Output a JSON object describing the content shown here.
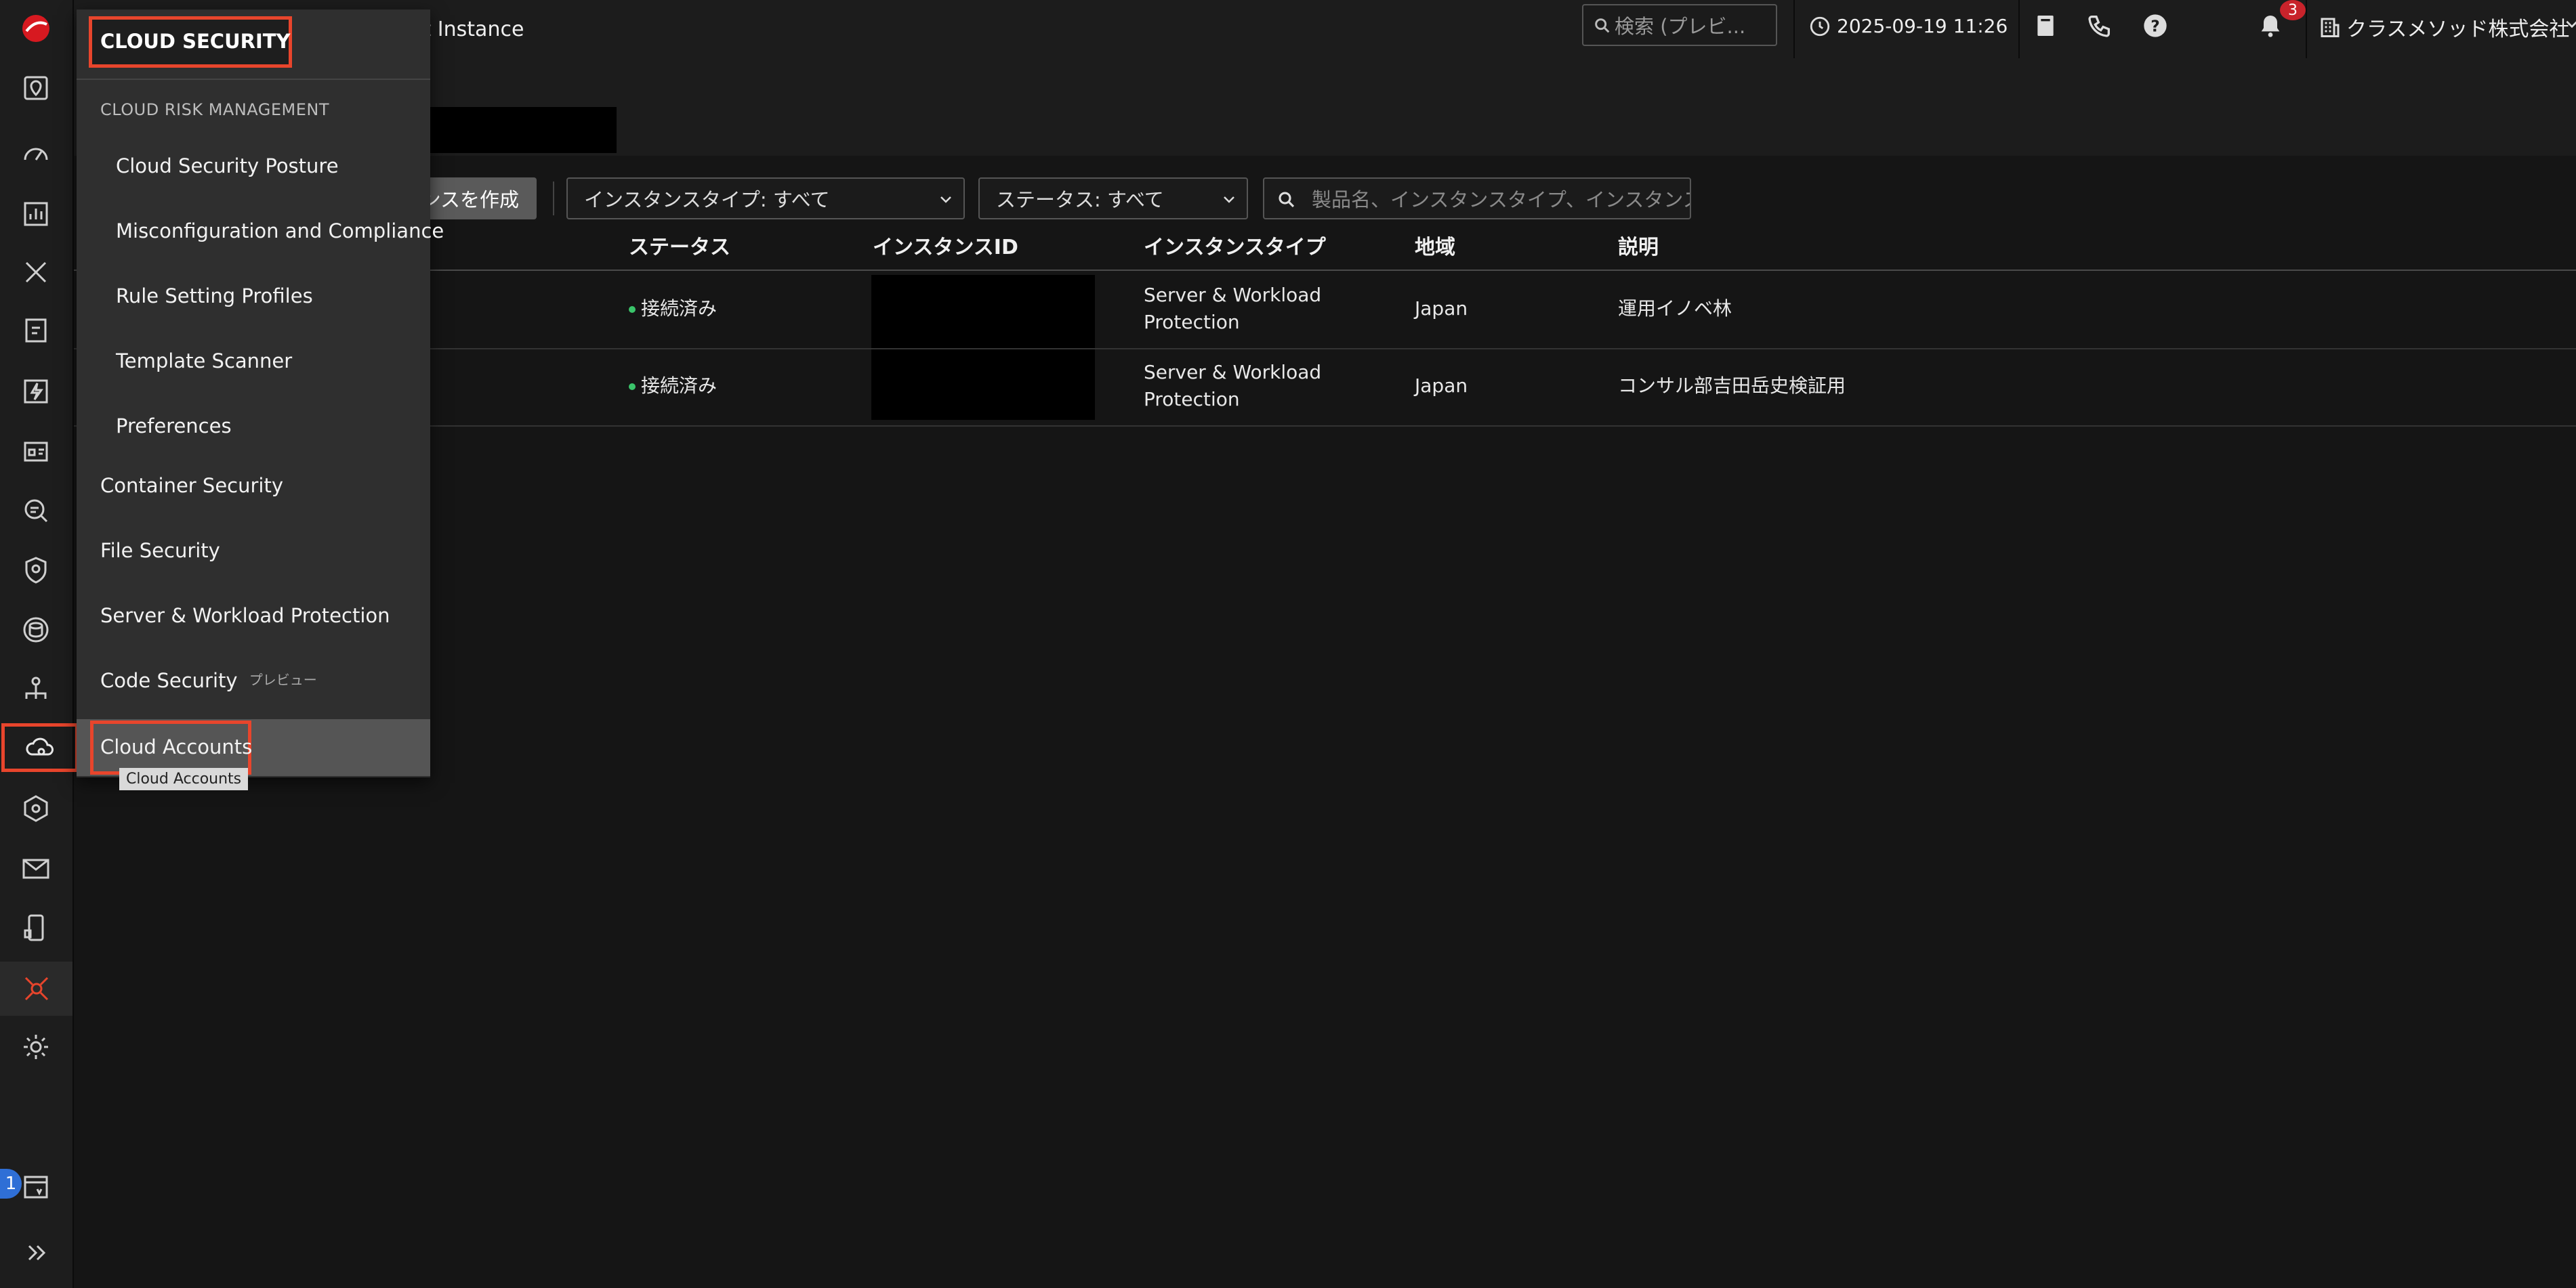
{
  "topbar": {
    "instance_label_partial": "uct Instance",
    "search_placeholder": "検索 (プレビ...",
    "datetime": "2025-09-19 11:26",
    "notification_count": "3",
    "company": "クラスメソッド株式会社"
  },
  "toolbar": {
    "create_button_partial": "ンスを作成",
    "instance_type_filter": "インスタンスタイプ: すべて",
    "status_filter": "ステータス: すべて",
    "search_placeholder": "製品名、インスタンスタイプ、インスタンス"
  },
  "table": {
    "headers": [
      "ステータス",
      "インスタンスID",
      "インスタンスタイプ",
      "地域",
      "説明"
    ],
    "rows": [
      {
        "status": "接続済み",
        "type_line1": "Server & Workload",
        "type_line2": "Protection",
        "region": "Japan",
        "description": "運用イノベ林"
      },
      {
        "status": "接続済み",
        "type_line1": "Server & Workload",
        "type_line2": "Protection",
        "region": "Japan",
        "description": "コンサル部吉田岳史検証用"
      }
    ]
  },
  "menu": {
    "title": "CLOUD SECURITY",
    "section": "CLOUD RISK MANAGEMENT",
    "sub_items": [
      "Cloud Security Posture",
      "Misconfiguration and Compliance",
      "Rule Setting Profiles",
      "Template Scanner",
      "Preferences"
    ],
    "items": [
      "Container Security",
      "File Security",
      "Server & Workload Protection"
    ],
    "code_security": "Code Security",
    "preview_tag": "プレビュー",
    "cloud_accounts": "Cloud Accounts",
    "tooltip": "Cloud Accounts"
  },
  "rail": {
    "bottom_badge": "1"
  },
  "colors": {
    "highlight": "#e8452c",
    "status_connected": "#3ac46a",
    "brand": "#d71920"
  }
}
